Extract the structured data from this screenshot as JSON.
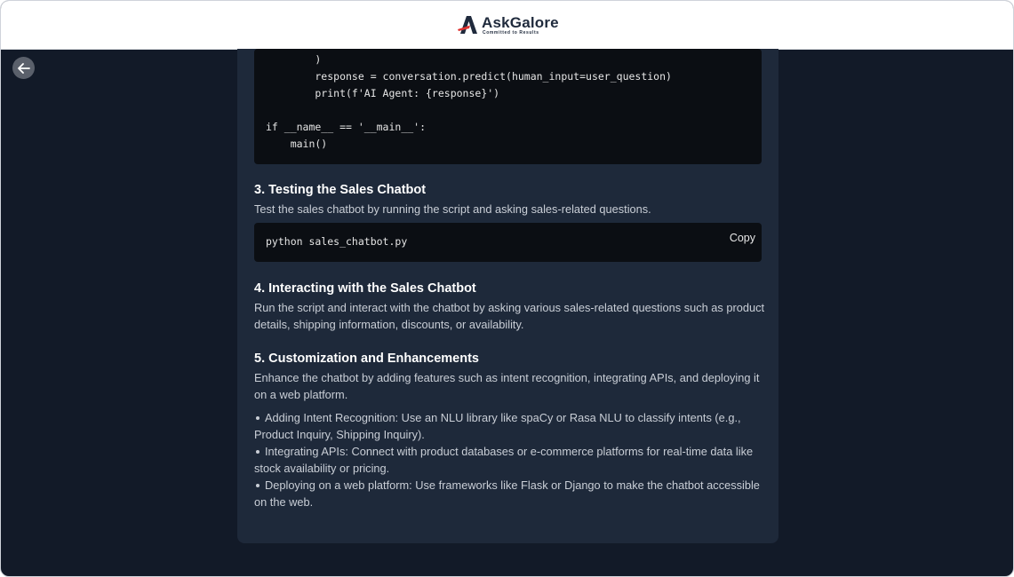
{
  "header": {
    "brand_name": "AskGalore",
    "brand_tagline": "Committed to Results"
  },
  "navigation": {
    "back_icon": "arrow-left-icon"
  },
  "content": {
    "code_block_1": {
      "lines": [
        "        )",
        "        response = conversation.predict(human_input=user_question)",
        "        print(f'AI Agent: {response}')",
        "",
        "if __name__ == '__main__':",
        "    main()"
      ]
    },
    "section_3": {
      "heading": "3. Testing the Sales Chatbot",
      "text": "Test the sales chatbot by running the script and asking sales-related questions."
    },
    "code_block_2": {
      "code": "python sales_chatbot.py",
      "copy_label": "Copy"
    },
    "section_4": {
      "heading": "4. Interacting with the Sales Chatbot",
      "text": "Run the script and interact with the chatbot by asking various sales-related questions such as product details, shipping information, discounts, or availability."
    },
    "section_5": {
      "heading": "5. Customization and Enhancements",
      "text": "Enhance the chatbot by adding features such as intent recognition, integrating APIs, and deploying it on a web platform.",
      "bullets": [
        "Adding Intent Recognition: Use an NLU library like spaCy or Rasa NLU to classify intents (e.g., Product Inquiry, Shipping Inquiry).",
        "Integrating APIs: Connect with product databases or e-commerce platforms for real-time data like stock availability or pricing.",
        "Deploying on a web platform: Use frameworks like Flask or Django to make the chatbot accessible on the web."
      ]
    }
  },
  "colors": {
    "page_background": "#121a28",
    "panel_background": "#1e293a",
    "code_background": "#0b0e13",
    "header_background": "#ffffff",
    "logo_accent": "#e0312f",
    "logo_dark": "#1f2a3c"
  }
}
